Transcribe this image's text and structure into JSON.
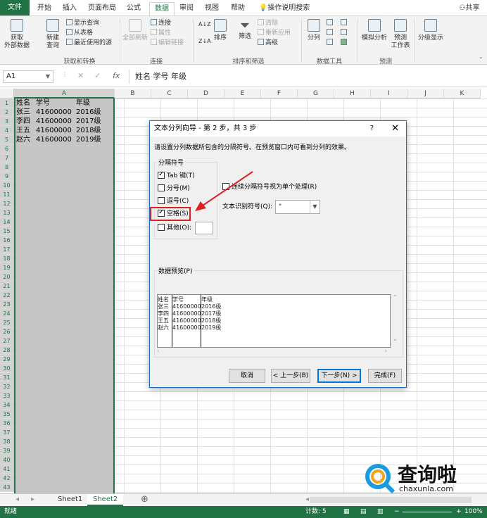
{
  "ribbon_tabs": [
    "文件",
    "开始",
    "插入",
    "页面布局",
    "公式",
    "数据",
    "审阅",
    "视图",
    "帮助",
    "操作说明搜索",
    "共享"
  ],
  "active_tab": "数据",
  "ribbon": {
    "get_external": "获取\n外部数据",
    "new_query": "新建\n查询",
    "show_queries": "显示查询",
    "from_table": "从表格",
    "recent_sources": "最近使用的源",
    "group_get_transform": "获取和转换",
    "refresh_all": "全部刷新",
    "connections": "连接",
    "properties": "属性",
    "edit_links": "编辑链接",
    "group_connections": "连接",
    "sort": "排序",
    "filter": "筛选",
    "clear": "清除",
    "reapply": "重新应用",
    "advanced": "高级",
    "group_sort_filter": "排序和筛选",
    "text_to_columns": "分列",
    "group_data_tools": "数据工具",
    "what_if": "模拟分析",
    "forecast_sheet": "预测\n工作表",
    "group_forecast": "预测",
    "outline": "分级显示"
  },
  "formula_bar": {
    "name_box": "A1",
    "content": "姓名 学号   年级"
  },
  "columns": [
    "A",
    "B",
    "C",
    "D",
    "E",
    "F",
    "G",
    "H",
    "I",
    "J",
    "K"
  ],
  "rows": [
    "1",
    "2",
    "3",
    "4",
    "5",
    "6",
    "7",
    "8",
    "9",
    "10",
    "11",
    "12",
    "13",
    "14",
    "15",
    "16",
    "17",
    "18",
    "19",
    "20",
    "21",
    "22",
    "23",
    "24",
    "25",
    "26",
    "27",
    "28",
    "29",
    "30",
    "31",
    "32",
    "33",
    "34",
    "35",
    "36",
    "37",
    "38",
    "39",
    "40",
    "41",
    "42",
    "43"
  ],
  "cells": [
    [
      "姓名",
      "学号",
      "年级"
    ],
    [
      "张三",
      "41600000",
      "2016级"
    ],
    [
      "李四",
      "41600000",
      "2017级"
    ],
    [
      "王五",
      "41600000",
      "2018级"
    ],
    [
      "赵六",
      "41600000",
      "2019级"
    ]
  ],
  "sheets": [
    "Sheet1",
    "Sheet2"
  ],
  "active_sheet": "Sheet2",
  "status": {
    "ready": "就绪",
    "count": "计数: 5",
    "zoom": "100%"
  },
  "dialog": {
    "title": "文本分列向导 - 第 2 步，共 3 步",
    "help": "?",
    "instruction": "请设置分列数据所包含的分隔符号。在预览窗口内可看到分列的效果。",
    "delimiters_legend": "分隔符号",
    "delimiters": [
      {
        "label": "Tab 键(T)",
        "checked": true
      },
      {
        "label": "分号(M)",
        "checked": false
      },
      {
        "label": "逗号(C)",
        "checked": false
      },
      {
        "label": "空格(S)",
        "checked": true
      },
      {
        "label": "其他(O):",
        "checked": false
      }
    ],
    "consecutive": "连续分隔符号视为单个处理(R)",
    "consecutive_checked": false,
    "qualifier_label": "文本识别符号(Q):",
    "qualifier_value": "\"",
    "preview_legend": "数据预览(P)",
    "preview_rows": [
      [
        "姓名",
        "学号",
        "年级"
      ],
      [
        "张三",
        "41600000",
        "2016级"
      ],
      [
        "李四",
        "41600000",
        "2017级"
      ],
      [
        "王五",
        "41600000",
        "2018级"
      ],
      [
        "赵六",
        "41600000",
        "2019级"
      ]
    ],
    "buttons": {
      "cancel": "取消",
      "back": "< 上一步(B)",
      "next": "下一步(N) >",
      "finish": "完成(F)"
    }
  },
  "watermark": {
    "text": "查询啦",
    "url": "chaxunla.com"
  },
  "colors": {
    "excel_green": "#217346",
    "highlight_red": "#e02020",
    "dialog_border": "#1e6fb8"
  }
}
